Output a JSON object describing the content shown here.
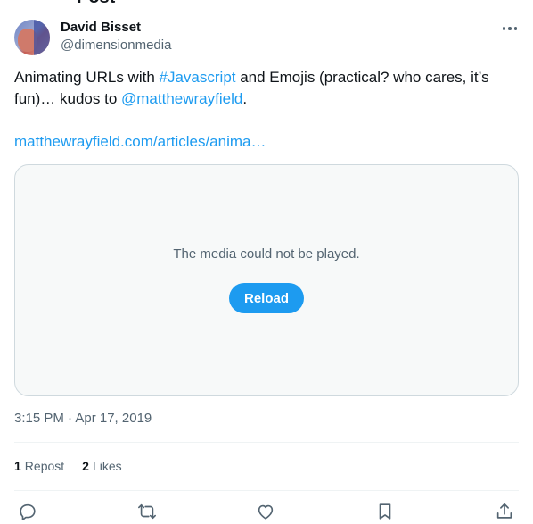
{
  "header": {
    "title_partial": "Post"
  },
  "author": {
    "name": "David Bisset",
    "handle": "@dimensionmedia"
  },
  "tweet": {
    "text_part1": "Animating URLs with ",
    "hashtag": "#Javascript",
    "text_part2": " and Emojis (practical? who cares, it’s fun)… kudos to ",
    "mention": "@matthewrayfield",
    "text_part3": ".",
    "url": "matthewrayfield.com/articles/anima…"
  },
  "media": {
    "error_message": "The media could not be played.",
    "reload_label": "Reload"
  },
  "timestamp": "3:15 PM · Apr 17, 2019",
  "stats": {
    "reposts_count": "1",
    "reposts_label": "Repost",
    "likes_count": "2",
    "likes_label": "Likes"
  },
  "actions": [
    "reply-icon",
    "repost-icon",
    "like-icon",
    "bookmark-icon",
    "share-icon"
  ],
  "colors": {
    "accent": "#1d9bf0",
    "secondary_text": "#536471",
    "primary_text": "#0f1419",
    "border": "#cfd9de"
  }
}
